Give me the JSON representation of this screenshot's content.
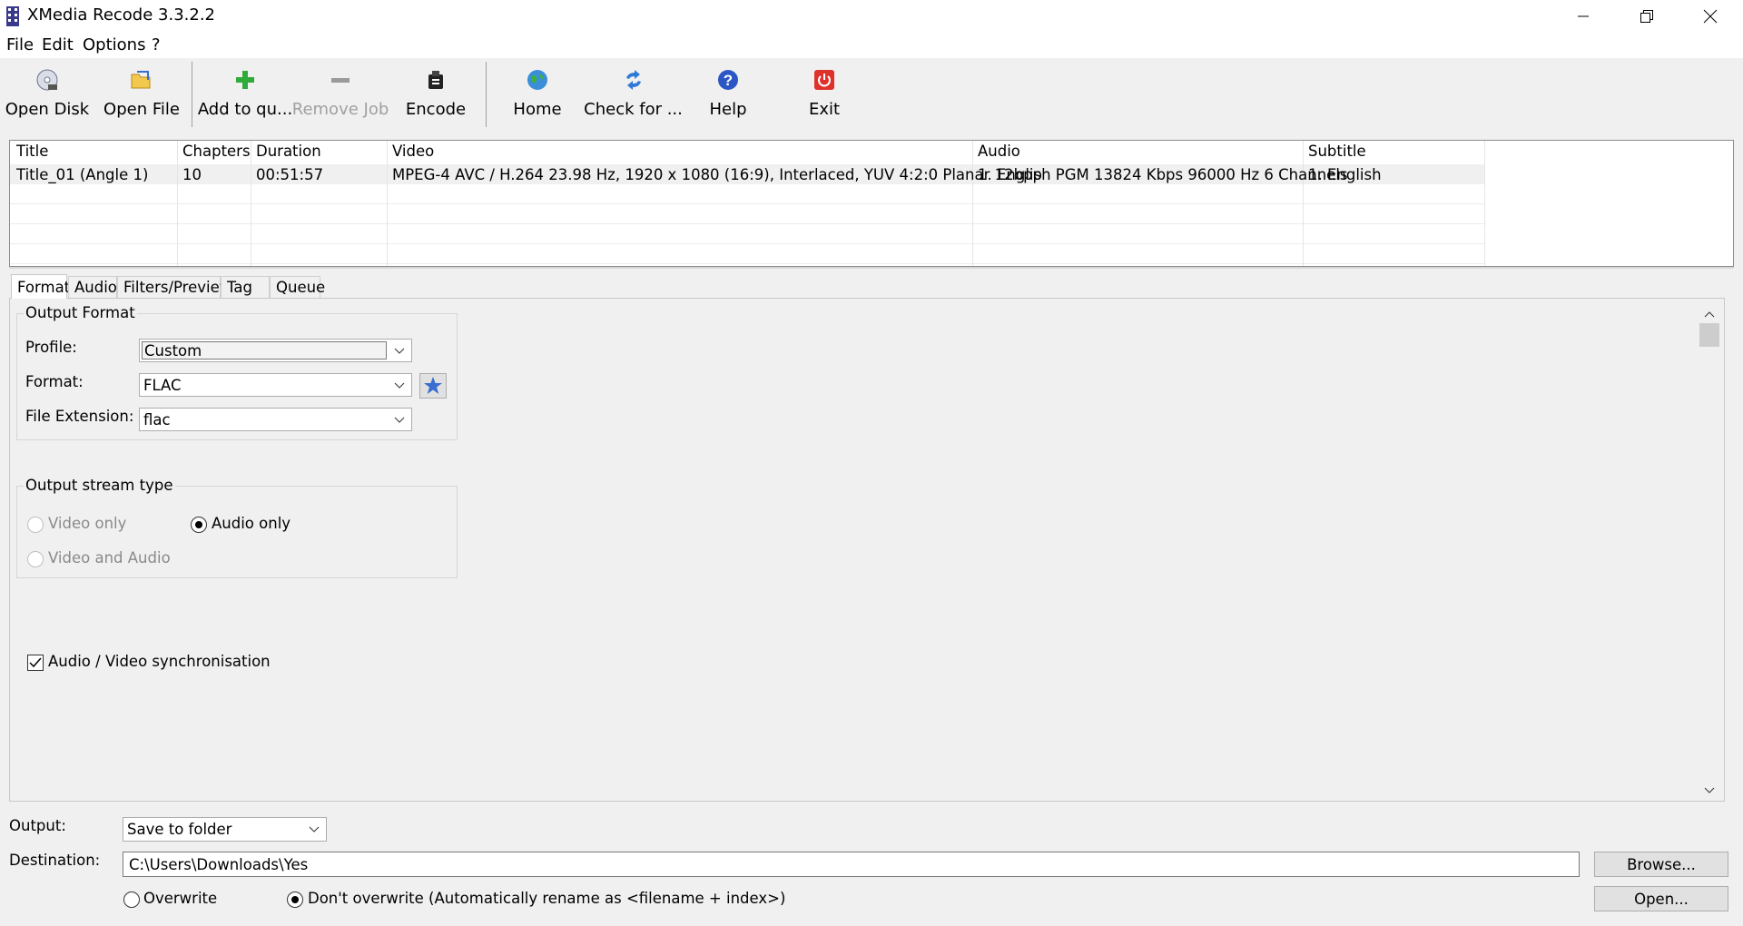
{
  "window": {
    "title": "XMedia Recode 3.3.2.2"
  },
  "menu": [
    "File",
    "Edit",
    "Options",
    "?"
  ],
  "toolbar": {
    "open_disk": "Open Disk",
    "open_file": "Open File",
    "add_to_queue": "Add to qu...",
    "remove_job": "Remove Job",
    "encode": "Encode",
    "home": "Home",
    "check_for": "Check for ...",
    "help": "Help",
    "exit": "Exit"
  },
  "list": {
    "columns": [
      "Title",
      "Chapters",
      "Duration",
      "Video",
      "Audio",
      "Subtitle"
    ],
    "rows": [
      {
        "title": "Title_01 (Angle 1)",
        "chapters": "10",
        "duration": "00:51:57",
        "video": "MPEG-4 AVC / H.264 23.98 Hz, 1920 x 1080 (16:9), Interlaced, YUV 4:2:0 Planar 12bpp",
        "audio": "1. English PGM 13824 Kbps 96000 Hz 6 Channels",
        "subtitle": "1. English"
      }
    ]
  },
  "tabs": [
    "Format",
    "Audio",
    "Filters/Preview",
    "Tag",
    "Queue"
  ],
  "format_tab": {
    "output_format": {
      "title": "Output Format",
      "profile_label": "Profile:",
      "profile_value": "Custom",
      "format_label": "Format:",
      "format_value": "FLAC",
      "extension_label": "File Extension:",
      "extension_value": "flac"
    },
    "stream_type": {
      "title": "Output stream type",
      "video_only": "Video only",
      "audio_only": "Audio only",
      "video_and_audio": "Video and Audio",
      "selected": "audio_only"
    },
    "av_sync": {
      "label": "Audio / Video synchronisation",
      "checked": true
    }
  },
  "output": {
    "output_label": "Output:",
    "output_value": "Save to folder",
    "destination_label": "Destination:",
    "destination_value": "C:\\Users\\Downloads\\Yes",
    "browse": "Browse...",
    "open": "Open...",
    "overwrite": "Overwrite",
    "dont_overwrite": "Don't overwrite (Automatically rename as <filename + index>)",
    "selected": "dont_overwrite"
  },
  "colors": {
    "accent_green": "#2eab3a",
    "exit_red": "#e0302a",
    "help_blue": "#2a56c6",
    "star_blue": "#3a6fd0"
  }
}
